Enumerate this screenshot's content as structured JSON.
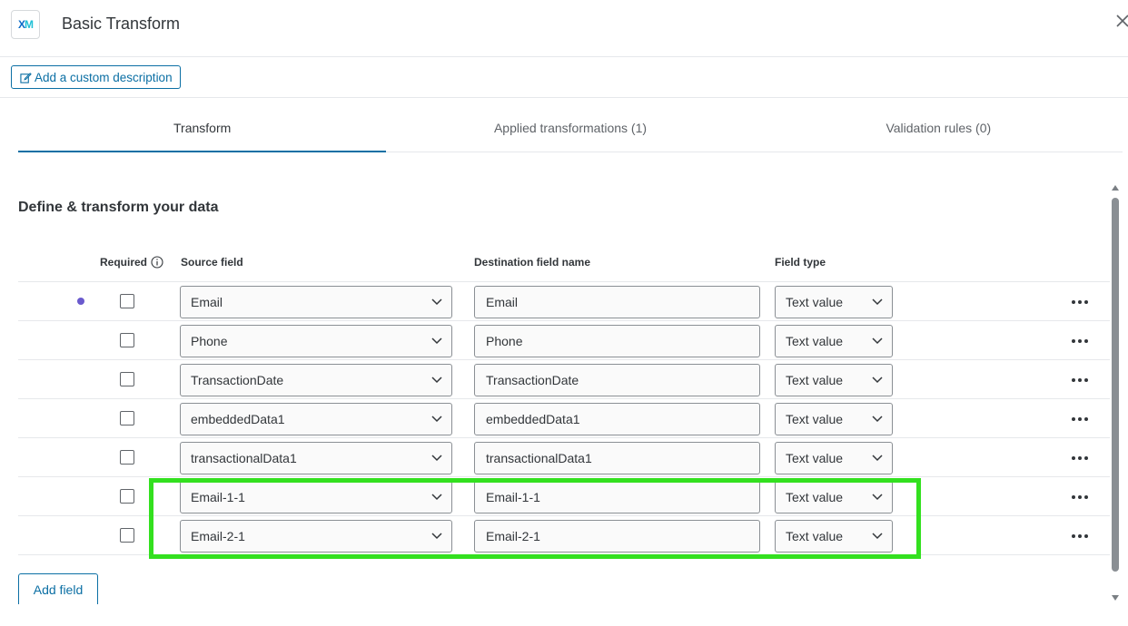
{
  "header": {
    "logo_text_a": "X",
    "logo_text_b": "M",
    "title": "Basic Transform"
  },
  "toolbar": {
    "add_description_label": "Add a custom description"
  },
  "tabs": [
    {
      "label": "Transform",
      "active": true
    },
    {
      "label": "Applied transformations (1)",
      "active": false
    },
    {
      "label": "Validation rules (0)",
      "active": false
    }
  ],
  "section": {
    "title": "Define & transform your data"
  },
  "columns": {
    "required": "Required",
    "source_field": "Source field",
    "destination_field": "Destination field name",
    "field_type": "Field type"
  },
  "rows": [
    {
      "source": "Email",
      "destination": "Email",
      "type": "Text value",
      "required": false
    },
    {
      "source": "Phone",
      "destination": "Phone",
      "type": "Text value",
      "required": false
    },
    {
      "source": "TransactionDate",
      "destination": "TransactionDate",
      "type": "Text value",
      "required": false
    },
    {
      "source": "embeddedData1",
      "destination": "embeddedData1",
      "type": "Text value",
      "required": false
    },
    {
      "source": "transactionalData1",
      "destination": "transactionalData1",
      "type": "Text value",
      "required": false
    },
    {
      "source": "Email-1-1",
      "destination": "Email-1-1",
      "type": "Text value",
      "required": false
    },
    {
      "source": "Email-2-1",
      "destination": "Email-2-1",
      "type": "Text value",
      "required": false
    }
  ],
  "footer": {
    "add_field_label": "Add field"
  },
  "colors": {
    "accent": "#0b6fa4",
    "highlight": "#33e01f",
    "indicator_dot": "#6a5acd"
  },
  "icons": {
    "close": "close-icon",
    "edit": "edit-icon",
    "info": "info-icon",
    "chevron": "chevron-down-icon",
    "more": "more-options-icon"
  }
}
